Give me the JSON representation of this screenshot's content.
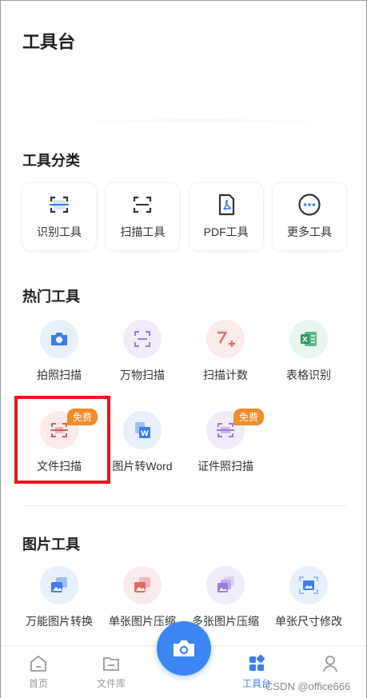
{
  "header": {
    "title": "工具台"
  },
  "categories": {
    "title": "工具分类",
    "items": [
      {
        "label": "识别工具",
        "icon": "scan-recognize-icon"
      },
      {
        "label": "扫描工具",
        "icon": "scan-frame-icon"
      },
      {
        "label": "PDF工具",
        "icon": "pdf-file-icon"
      },
      {
        "label": "更多工具",
        "icon": "more-dots-icon"
      }
    ]
  },
  "hot_tools": {
    "title": "热门工具",
    "items": [
      {
        "label": "拍照扫描",
        "icon": "camera-icon"
      },
      {
        "label": "万物扫描",
        "icon": "scan-object-icon"
      },
      {
        "label": "扫描计数",
        "icon": "count-icon"
      },
      {
        "label": "表格识别",
        "icon": "excel-icon"
      },
      {
        "label": "文件扫描",
        "icon": "document-scan-icon",
        "badge": "免费"
      },
      {
        "label": "图片转Word",
        "icon": "word-icon"
      },
      {
        "label": "证件照扫描",
        "icon": "id-card-scan-icon",
        "badge": "免费"
      }
    ]
  },
  "image_tools": {
    "title": "图片工具",
    "items": [
      {
        "label": "万能图片转换",
        "icon": "image-convert-icon"
      },
      {
        "label": "单张图片压缩",
        "icon": "image-compress-icon"
      },
      {
        "label": "多张图片压缩",
        "icon": "images-compress-icon"
      },
      {
        "label": "单张尺寸修改",
        "icon": "image-resize-icon"
      }
    ]
  },
  "bottom_nav": {
    "items": [
      {
        "label": "首页",
        "icon": "home-icon"
      },
      {
        "label": "文件库",
        "icon": "folder-icon"
      },
      {
        "label": "工具台",
        "icon": "grid-tools-icon",
        "active": true
      },
      {
        "label": "",
        "icon": "user-icon"
      }
    ],
    "fab_icon": "camera-icon"
  },
  "watermark": "CSDN @office666",
  "colors": {
    "accent": "#3c86f4",
    "badge": "#f28b2c",
    "highlight": "#e8161f"
  }
}
